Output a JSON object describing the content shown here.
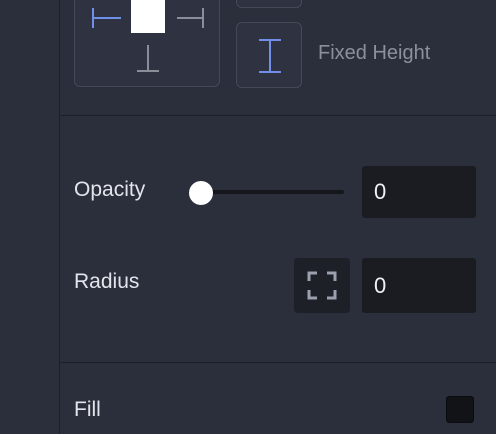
{
  "constraints": {
    "fixed_height_label": "Fixed Height"
  },
  "opacity": {
    "label": "Opacity",
    "value": "0",
    "slider_fraction": 0
  },
  "radius": {
    "label": "Radius",
    "value": "0"
  },
  "fill": {
    "label": "Fill",
    "color": "#121317"
  },
  "colors": {
    "panel_bg": "#2b2e3b",
    "accent": "#6f8fe8",
    "input_bg": "#1a1c22"
  }
}
